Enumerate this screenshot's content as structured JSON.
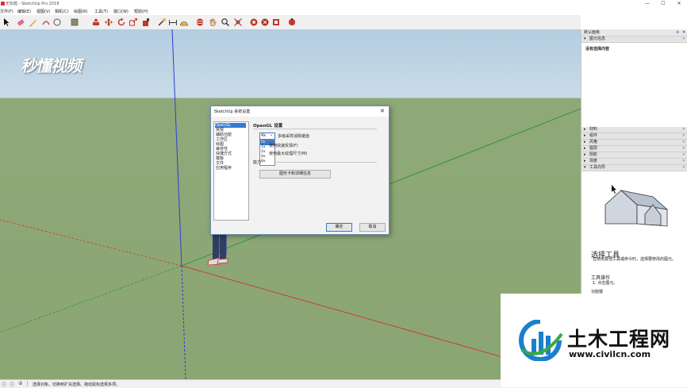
{
  "window": {
    "title": "无标题 - SketchUp Pro 2018",
    "controls": [
      "—",
      "☐",
      "✕"
    ]
  },
  "menu": [
    "文件(F)",
    "编辑(E)",
    "视图(V)",
    "相机(C)",
    "绘图(R)",
    "工具(T)",
    "窗口(W)",
    "帮助(H)"
  ],
  "watermark": "秒懂视频",
  "dialog": {
    "title": "SketchUp 系统设置",
    "close": "✕",
    "categories": [
      "OpenGL",
      "常规",
      "辅助功能",
      "工作区",
      "绘图",
      "兼容性",
      "快捷方式",
      "模板",
      "文件",
      "应用程序"
    ],
    "section_title": "OpenGL 设置",
    "aa_value": "4x",
    "aa_label": "多级采样消除锯齿",
    "aa_options": [
      "0x",
      "1x",
      "2x",
      "4x",
      "8x"
    ],
    "option1": "使用快速反馈(F)",
    "option2": "使用最大纹理尺寸(M)",
    "section2": "能力",
    "details_button": "图形卡和详细信息",
    "ok": "确定",
    "cancel": "取消"
  },
  "tray": {
    "title": "默认面板",
    "entity_info": "图元信息",
    "no_selection": "没有选择内容",
    "panels": [
      "材料",
      "组件",
      "风格",
      "图层",
      "阴影",
      "场景",
      "工具向导"
    ],
    "instructor": {
      "tool_title": "选择工具",
      "tool_desc": "在使用其他工具或命令时，选择要修改的图元。",
      "ops_title": "工具操作",
      "ops_item": "1. 点击图元。",
      "more": "功能键"
    }
  },
  "status": {
    "text": "选择对象。切换到扩充选择。拖动鼠标选择多项。"
  },
  "logo": {
    "name": "土木工程网",
    "url": "www.civilcn.com"
  },
  "colors": {
    "sky": "#c4d8e6",
    "ground": "#8ba774",
    "accent_blue": "#1b7fcc",
    "logo_green": "#3aa845"
  }
}
